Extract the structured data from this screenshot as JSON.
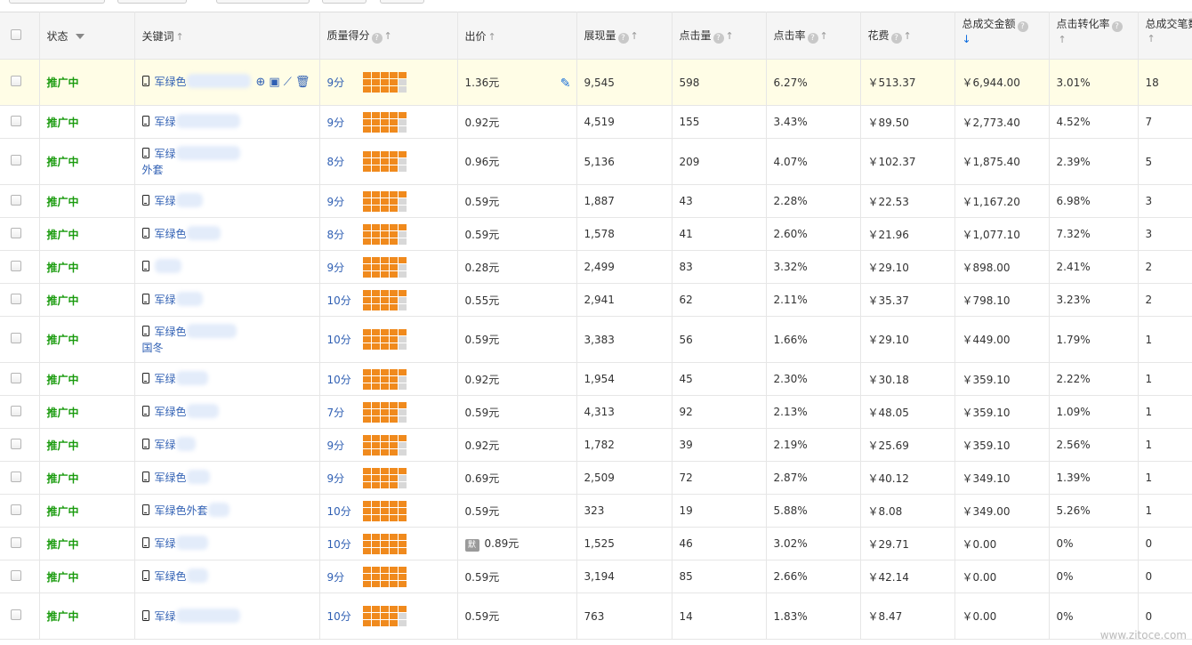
{
  "columns": {
    "status": "状态",
    "keyword": "关键词",
    "quality": "质量得分",
    "bid": "出价",
    "impressions": "展现量",
    "clicks": "点击量",
    "ctr": "点击率",
    "cost": "花费",
    "total_amount": "总成交金额",
    "conv_rate": "点击转化率",
    "total_orders": "总成交笔数"
  },
  "rows": [
    {
      "status": "推广中",
      "kw1": "军绿色",
      "kw2": "",
      "score": "9分",
      "bars": 13,
      "bid": "1.36元",
      "bid_tag": "",
      "imp": "9,545",
      "clk": "598",
      "ctr": "6.27%",
      "cost": "￥513.37",
      "amount": "￥6,944.00",
      "conv": "3.01%",
      "orders": "18"
    },
    {
      "status": "推广中",
      "kw1": "军绿",
      "kw2": "",
      "score": "9分",
      "bars": 13,
      "bid": "0.92元",
      "bid_tag": "",
      "imp": "4,519",
      "clk": "155",
      "ctr": "3.43%",
      "cost": "￥89.50",
      "amount": "￥2,773.40",
      "conv": "4.52%",
      "orders": "7"
    },
    {
      "status": "推广中",
      "kw1": "军绿",
      "kw2": "外套",
      "score": "8分",
      "bars": 13,
      "bid": "0.96元",
      "bid_tag": "",
      "imp": "5,136",
      "clk": "209",
      "ctr": "4.07%",
      "cost": "￥102.37",
      "amount": "￥1,875.40",
      "conv": "2.39%",
      "orders": "5"
    },
    {
      "status": "推广中",
      "kw1": "军绿",
      "kw2": "",
      "score": "9分",
      "bars": 13,
      "bid": "0.59元",
      "bid_tag": "",
      "imp": "1,887",
      "clk": "43",
      "ctr": "2.28%",
      "cost": "￥22.53",
      "amount": "￥1,167.20",
      "conv": "6.98%",
      "orders": "3"
    },
    {
      "status": "推广中",
      "kw1": "军绿色",
      "kw2": "",
      "score": "8分",
      "bars": 13,
      "bid": "0.59元",
      "bid_tag": "",
      "imp": "1,578",
      "clk": "41",
      "ctr": "2.60%",
      "cost": "￥21.96",
      "amount": "￥1,077.10",
      "conv": "7.32%",
      "orders": "3"
    },
    {
      "status": "推广中",
      "kw1": "",
      "kw2": "",
      "score": "9分",
      "bars": 13,
      "bid": "0.28元",
      "bid_tag": "",
      "imp": "2,499",
      "clk": "83",
      "ctr": "3.32%",
      "cost": "￥29.10",
      "amount": "￥898.00",
      "conv": "2.41%",
      "orders": "2"
    },
    {
      "status": "推广中",
      "kw1": "军绿",
      "kw2": "",
      "score": "10分",
      "bars": 13,
      "bid": "0.55元",
      "bid_tag": "",
      "imp": "2,941",
      "clk": "62",
      "ctr": "2.11%",
      "cost": "￥35.37",
      "amount": "￥798.10",
      "conv": "3.23%",
      "orders": "2"
    },
    {
      "status": "推广中",
      "kw1": "军绿色",
      "kw2": "国冬",
      "score": "10分",
      "bars": 13,
      "bid": "0.59元",
      "bid_tag": "",
      "imp": "3,383",
      "clk": "56",
      "ctr": "1.66%",
      "cost": "￥29.10",
      "amount": "￥449.00",
      "conv": "1.79%",
      "orders": "1"
    },
    {
      "status": "推广中",
      "kw1": "军绿",
      "kw2": "",
      "score": "10分",
      "bars": 13,
      "bid": "0.92元",
      "bid_tag": "",
      "imp": "1,954",
      "clk": "45",
      "ctr": "2.30%",
      "cost": "￥30.18",
      "amount": "￥359.10",
      "conv": "2.22%",
      "orders": "1"
    },
    {
      "status": "推广中",
      "kw1": "军绿色",
      "kw2": "",
      "score": "7分",
      "bars": 13,
      "bid": "0.59元",
      "bid_tag": "",
      "imp": "4,313",
      "clk": "92",
      "ctr": "2.13%",
      "cost": "￥48.05",
      "amount": "￥359.10",
      "conv": "1.09%",
      "orders": "1"
    },
    {
      "status": "推广中",
      "kw1": "军绿",
      "kw2": "",
      "score": "9分",
      "bars": 13,
      "bid": "0.92元",
      "bid_tag": "",
      "imp": "1,782",
      "clk": "39",
      "ctr": "2.19%",
      "cost": "￥25.69",
      "amount": "￥359.10",
      "conv": "2.56%",
      "orders": "1"
    },
    {
      "status": "推广中",
      "kw1": "军绿色",
      "kw2": "",
      "score": "9分",
      "bars": 13,
      "bid": "0.69元",
      "bid_tag": "",
      "imp": "2,509",
      "clk": "72",
      "ctr": "2.87%",
      "cost": "￥40.12",
      "amount": "￥349.10",
      "conv": "1.39%",
      "orders": "1"
    },
    {
      "status": "推广中",
      "kw1": "军绿色外套",
      "kw2": "",
      "score": "10分",
      "bars": 15,
      "bid": "0.59元",
      "bid_tag": "",
      "imp": "323",
      "clk": "19",
      "ctr": "5.88%",
      "cost": "￥8.08",
      "amount": "￥349.00",
      "conv": "5.26%",
      "orders": "1"
    },
    {
      "status": "推广中",
      "kw1": "军绿",
      "kw2": "",
      "score": "10分",
      "bars": 15,
      "bid": "0.89元",
      "bid_tag": "默",
      "imp": "1,525",
      "clk": "46",
      "ctr": "3.02%",
      "cost": "￥29.71",
      "amount": "￥0.00",
      "conv": "0%",
      "orders": "0"
    },
    {
      "status": "推广中",
      "kw1": "军绿色",
      "kw2": "",
      "score": "9分",
      "bars": 15,
      "bid": "0.59元",
      "bid_tag": "",
      "imp": "3,194",
      "clk": "85",
      "ctr": "2.66%",
      "cost": "￥42.14",
      "amount": "￥0.00",
      "conv": "0%",
      "orders": "0"
    },
    {
      "status": "推广中",
      "kw1": "军绿",
      "kw2": "",
      "score": "10分",
      "bars": 13,
      "bid": "0.59元",
      "bid_tag": "",
      "imp": "763",
      "clk": "14",
      "ctr": "1.83%",
      "cost": "￥8.47",
      "amount": "￥0.00",
      "conv": "0%",
      "orders": "0"
    }
  ],
  "icons": [
    "mobile-icon",
    "target-icon",
    "mobile-chart-icon",
    "trend-chart-icon",
    "trash-icon",
    "pencil-icon",
    "help-icon",
    "sort-up-icon",
    "sort-down-icon"
  ],
  "watermark": "www.zitoce.com",
  "colors": {
    "status": "#1a9b0e",
    "link": "#2f5fb3",
    "bar_on": "#f08a1d",
    "bar_off": "#d8d8d8",
    "highlight_row": "#fffde6"
  }
}
